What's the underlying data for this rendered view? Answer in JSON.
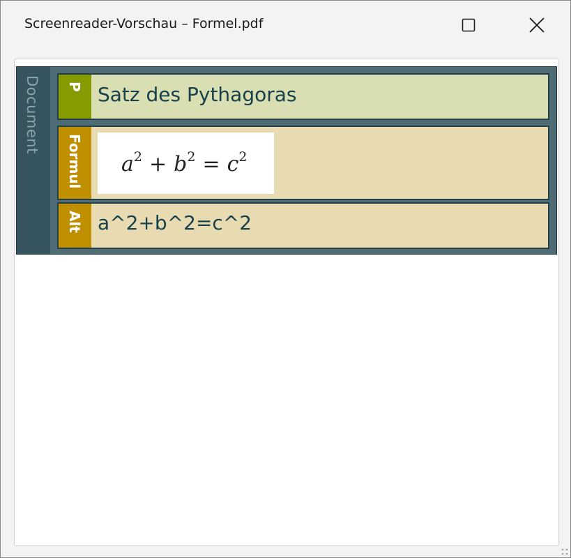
{
  "window": {
    "title": "Screenreader-Vorschau – Formel.pdf"
  },
  "tree": {
    "root_label": "Document",
    "nodes": [
      {
        "tag": "P",
        "text": "Satz des Pythagoras"
      },
      {
        "tag": "Formul",
        "formula": {
          "a": "a",
          "b": "b",
          "c": "c",
          "exp": "2",
          "plus": "+",
          "eq": "="
        }
      },
      {
        "tag": "Alt",
        "text": "a^2+b^2=c^2"
      }
    ]
  },
  "colors": {
    "tree_bg": "#35545e",
    "p_tag": "#869b00",
    "p_body": "#d9dfb3",
    "formula_tag": "#c08f00",
    "formula_body": "#e8dbb2",
    "text": "#17404b"
  },
  "icons": [
    "maximize-icon",
    "close-icon",
    "resize-grip-icon"
  ]
}
